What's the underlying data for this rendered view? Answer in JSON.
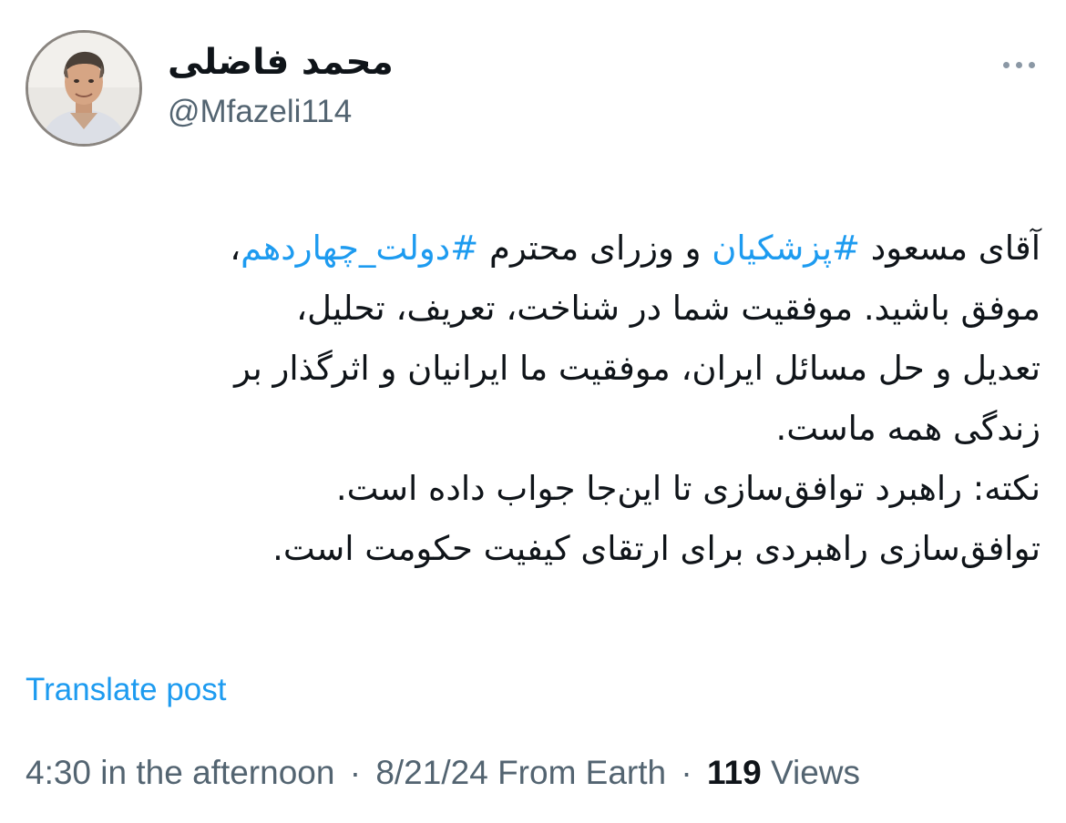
{
  "author": {
    "display_name": "محمد فاضلی",
    "handle": "@Mfazeli114"
  },
  "more_icon": "more-horizontal-icon",
  "tweet": {
    "lines": [
      {
        "segments": [
          {
            "text": "آقای مسعود ",
            "type": "text"
          },
          {
            "text": "#پزشکیان",
            "type": "hashtag"
          },
          {
            "text": " و وزرای محترم ",
            "type": "text"
          },
          {
            "text": "#دولت_چهاردهم",
            "type": "hashtag"
          },
          {
            "text": "،",
            "type": "text"
          }
        ]
      },
      {
        "segments": [
          {
            "text": "موفق باشید. موفقیت شما در شناخت، تعریف، تحلیل،",
            "type": "text"
          }
        ]
      },
      {
        "segments": [
          {
            "text": "تعدیل و حل مسائل ایران، موفقیت ما ایرانیان و اثرگذار بر",
            "type": "text"
          }
        ]
      },
      {
        "segments": [
          {
            "text": "زندگی همه ماست.",
            "type": "text"
          }
        ]
      },
      {
        "segments": [
          {
            "text": "نکته: راهبرد توافق‌سازی تا این‌جا جواب داده است.",
            "type": "text"
          }
        ]
      },
      {
        "segments": [
          {
            "text": "توافق‌سازی راهبردی برای ارتقای کیفیت حکومت است.",
            "type": "text"
          }
        ]
      }
    ]
  },
  "translate_label": "Translate post",
  "meta": {
    "time": "4:30 in the afternoon",
    "separator": "·",
    "date": "8/21/24",
    "source": "From Earth",
    "views_count": "119",
    "views_label": "Views"
  },
  "colors": {
    "link": "#1d9bf0",
    "secondary_text": "#536471",
    "primary_text": "#0f1419"
  }
}
